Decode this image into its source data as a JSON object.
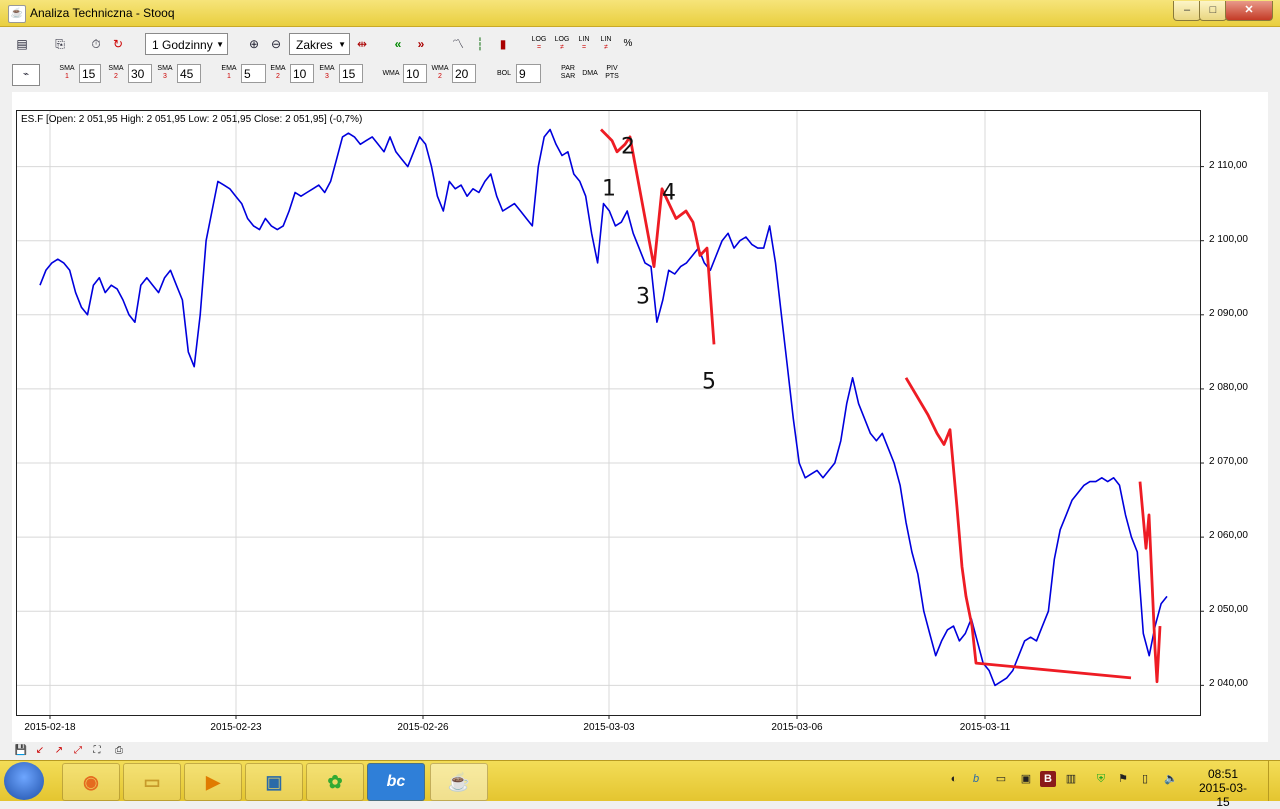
{
  "window": {
    "title": "Analiza Techniczna - Stooq",
    "min": "–",
    "max": "□",
    "close": "✕"
  },
  "toolbar1": {
    "interval": "1 Godzinny",
    "range": "Zakres",
    "buttons": {
      "log_eq": [
        "LOG",
        "="
      ],
      "log_ne": [
        "LOG",
        "≠"
      ],
      "lin_eq": [
        "LIN",
        "="
      ],
      "lin_ne": [
        "LIN",
        "≠"
      ],
      "percent": "%"
    }
  },
  "toolbar2": {
    "sma": [
      {
        "label": "SMA",
        "n": "1",
        "value": "15"
      },
      {
        "label": "SMA",
        "n": "2",
        "value": "30"
      },
      {
        "label": "SMA",
        "n": "3",
        "value": "45"
      }
    ],
    "ema": [
      {
        "label": "EMA",
        "n": "1",
        "value": "5"
      },
      {
        "label": "EMA",
        "n": "2",
        "value": "10"
      },
      {
        "label": "EMA",
        "n": "3",
        "value": "15"
      }
    ],
    "wma": [
      {
        "label": "WMA",
        "value": "10"
      },
      {
        "label": "WMA",
        "n": "2",
        "value": "20"
      }
    ],
    "bol": {
      "label": "BOL",
      "value": "9"
    },
    "parsar": [
      "PAR",
      "SAR"
    ],
    "dma": "DMA",
    "pivpts": [
      "PIV",
      "PTS"
    ]
  },
  "chart_data": {
    "type": "line",
    "ohlc_text": "ES.F [Open: 2 051,95  High: 2 051,95  Low: 2 051,95  Close: 2 051,95] (-0,7%)",
    "x_ticks": [
      "2015-02-18",
      "2015-02-23",
      "2015-02-26",
      "2015-03-03",
      "2015-03-06",
      "2015-03-11"
    ],
    "y_ticks": [
      "2 040,00",
      "2 050,00",
      "2 060,00",
      "2 070,00",
      "2 080,00",
      "2 090,00",
      "2 100,00",
      "2 110,00"
    ],
    "ylim": [
      2036,
      2117.5
    ],
    "series": [
      {
        "color": "#0000dd",
        "y": [
          2094,
          2096,
          2097,
          2097.5,
          2097,
          2096,
          2093,
          2091,
          2090,
          2094,
          2095,
          2093,
          2094,
          2093.5,
          2092,
          2090,
          2089,
          2094,
          2095,
          2094,
          2093,
          2095,
          2096,
          2094,
          2092,
          2085,
          2083,
          2090,
          2100,
          2104,
          2108,
          2107.5,
          2107,
          2106,
          2105,
          2103,
          2102,
          2101.5,
          2103,
          2102,
          2101.5,
          2102,
          2104,
          2106.5,
          2106,
          2106.5,
          2107,
          2107.5,
          2106.5,
          2108,
          2111,
          2114,
          2114.5,
          2114,
          2113,
          2113.5,
          2114,
          2113,
          2112,
          2114,
          2112,
          2111,
          2110,
          2112,
          2114,
          2113,
          2110,
          2106,
          2104,
          2108,
          2107,
          2107.5,
          2106,
          2107,
          2106.5,
          2108,
          2109,
          2106,
          2104,
          2104.5,
          2105,
          2104,
          2103,
          2102,
          2110,
          2114,
          2115,
          2113,
          2111.5,
          2112,
          2109,
          2108,
          2106,
          2101,
          2097,
          2105,
          2104,
          2102,
          2102.5,
          2104,
          2101,
          2099,
          2097,
          2096.5,
          2089,
          2092,
          2096,
          2095.5,
          2096.5,
          2097,
          2098,
          2099,
          2097,
          2096,
          2098,
          2100,
          2101,
          2099,
          2100,
          2100.5,
          2099.5,
          2099,
          2099,
          2102,
          2097,
          2090,
          2083,
          2076,
          2070,
          2068,
          2068.5,
          2069,
          2068,
          2069,
          2070,
          2073,
          2078,
          2081.5,
          2078,
          2076,
          2074,
          2073,
          2074,
          2072,
          2070,
          2067,
          2062,
          2058,
          2055,
          2050,
          2047,
          2044,
          2046,
          2047.5,
          2048,
          2046,
          2047,
          2049,
          2046,
          2043,
          2042,
          2040,
          2040.5,
          2041,
          2042,
          2044,
          2046,
          2046.5,
          2046,
          2048,
          2050,
          2057,
          2061,
          2063,
          2065,
          2066,
          2067,
          2067.5,
          2067.5,
          2068,
          2067.5,
          2068,
          2067,
          2063,
          2060,
          2058,
          2047,
          2044,
          2048,
          2051,
          2052
        ]
      },
      {
        "color": "#ee1c24",
        "y": [
          2115,
          2113.5,
          2112,
          2113,
          2114,
          2096.5,
          2107,
          2103,
          2104,
          2102.5,
          2098,
          2099,
          2086,
          2081.5,
          2076.5,
          2074,
          2072.5,
          2074.5,
          2064,
          2056,
          2052,
          2048,
          2043,
          2041,
          2067.5,
          2058.5,
          2063,
          2045,
          2040.5,
          2048
        ]
      }
    ],
    "annotations": [
      "1",
      "2",
      "3",
      "4",
      "5"
    ]
  },
  "taskbar": {
    "apps": [
      "firefox",
      "explorer",
      "media-player",
      "image-viewer",
      "picasa",
      "bc",
      "java"
    ],
    "time": "08:51",
    "date": "2015-03-15"
  }
}
